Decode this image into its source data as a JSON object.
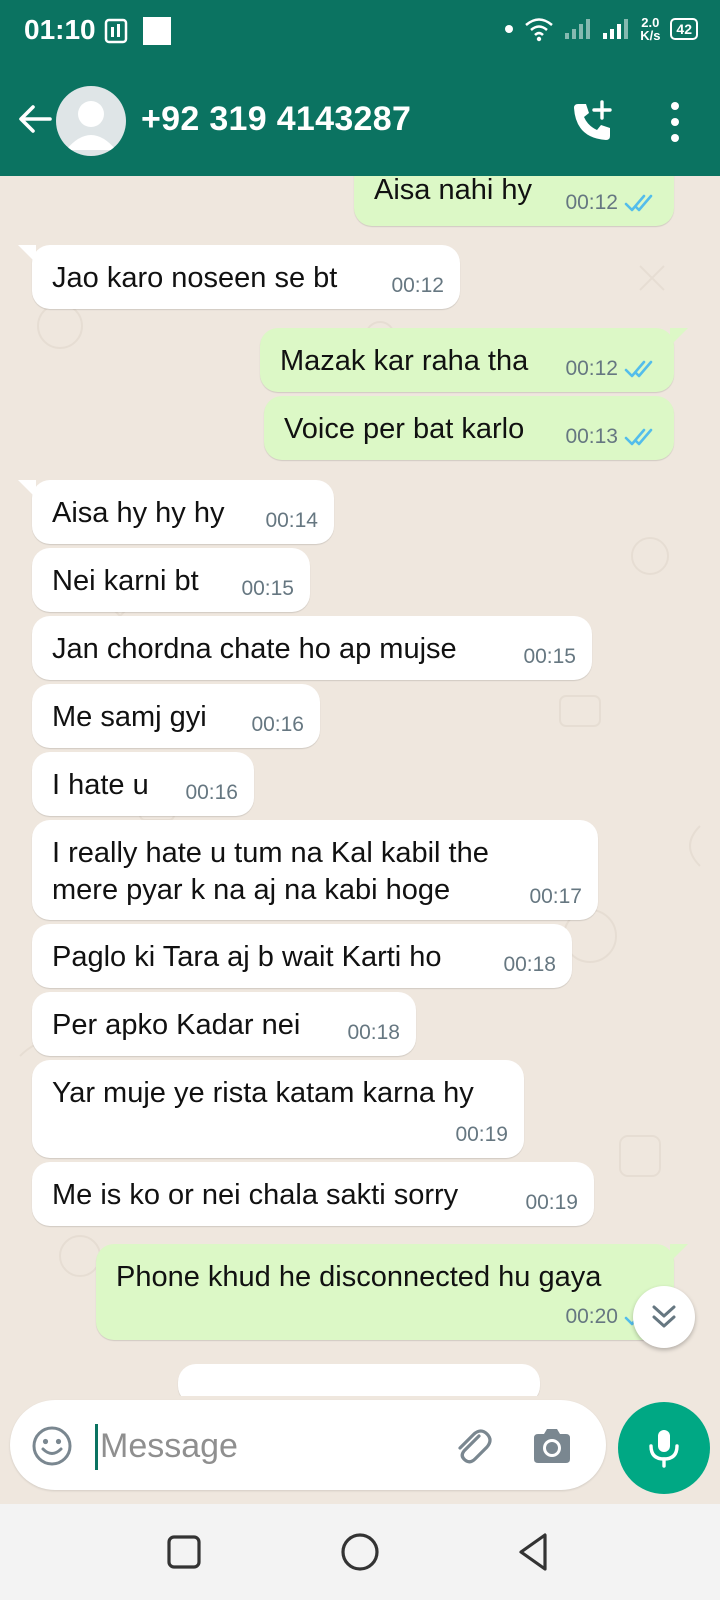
{
  "status_bar": {
    "time": "01:10",
    "net_speed_value": "2.0",
    "net_speed_unit": "K/s",
    "battery": "42"
  },
  "header": {
    "contact": "+92 319 4143287"
  },
  "messages": [
    {
      "dir": "out",
      "text": "Aisa nahi hy",
      "time": "00:12",
      "read": true
    },
    {
      "dir": "in",
      "text": "Jao karo noseen se bt",
      "time": "00:12"
    },
    {
      "dir": "out",
      "text": "Mazak kar raha tha",
      "time": "00:12",
      "read": true
    },
    {
      "dir": "out",
      "text": "Voice per bat karlo",
      "time": "00:13",
      "read": true
    },
    {
      "dir": "in",
      "text": "Aisa hy hy hy",
      "time": "00:14"
    },
    {
      "dir": "in",
      "text": "Nei karni bt",
      "time": "00:15"
    },
    {
      "dir": "in",
      "text": "Jan chordna chate ho ap mujse",
      "time": "00:15"
    },
    {
      "dir": "in",
      "text": "Me samj gyi",
      "time": "00:16"
    },
    {
      "dir": "in",
      "text": "I hate u",
      "time": "00:16"
    },
    {
      "dir": "in",
      "text": "I really hate u tum na Kal kabil the",
      "text2": "mere pyar k na aj na kabi hoge",
      "time": "00:17"
    },
    {
      "dir": "in",
      "text": "Paglo ki Tara aj b wait Karti ho",
      "time": "00:18"
    },
    {
      "dir": "in",
      "text": "Per apko Kadar nei",
      "time": "00:18"
    },
    {
      "dir": "in",
      "text": "Yar muje ye rista katam karna hy",
      "time": "00:19"
    },
    {
      "dir": "in",
      "text": "Me is ko or nei chala sakti sorry",
      "time": "00:19"
    },
    {
      "dir": "out",
      "text": "Phone khud he disconnected hu gaya",
      "time": "00:20",
      "read": true
    }
  ],
  "input": {
    "placeholder": "Message"
  },
  "colors": {
    "header": "#0b7361",
    "outgoing_bubble": "#dcf8c6",
    "incoming_bubble": "#ffffff",
    "read_tick": "#53bdeb",
    "mic_button": "#00a884"
  }
}
